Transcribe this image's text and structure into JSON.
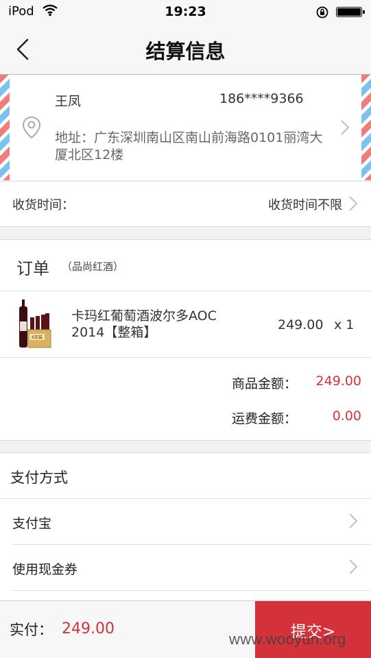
{
  "status_bar": {
    "carrier": "iPod",
    "time": "19:23"
  },
  "nav": {
    "title": "结算信息"
  },
  "address": {
    "name": "王凤",
    "phone": "186****9366",
    "detail": "地址：广东深圳南山区南山前海路0101丽湾大厦北区12楼"
  },
  "delivery": {
    "label": "收货时间：",
    "value": "收货时间不限"
  },
  "order": {
    "title": "订单",
    "store": "（品尚红酒）",
    "product": {
      "name": "卡玛红葡萄酒波尔多AOC 2014【整箱】",
      "price": "249.00",
      "qty": "x 1",
      "thumb_text": "6支装"
    },
    "goods_label": "商品金额：",
    "goods_value": "249.00",
    "shipping_label": "运费金额：",
    "shipping_value": "0.00"
  },
  "payment": {
    "title": "支付方式",
    "options": [
      {
        "label": "支付宝"
      },
      {
        "label": "使用现金券"
      }
    ]
  },
  "footer": {
    "total_label": "实付：",
    "total_value": "249.00",
    "submit_label": "提交>"
  },
  "watermark": "www.wooyun.org",
  "colors": {
    "accent": "#d4323b",
    "airmail_red": "#f07c7c",
    "airmail_blue": "#7cc2f0"
  }
}
